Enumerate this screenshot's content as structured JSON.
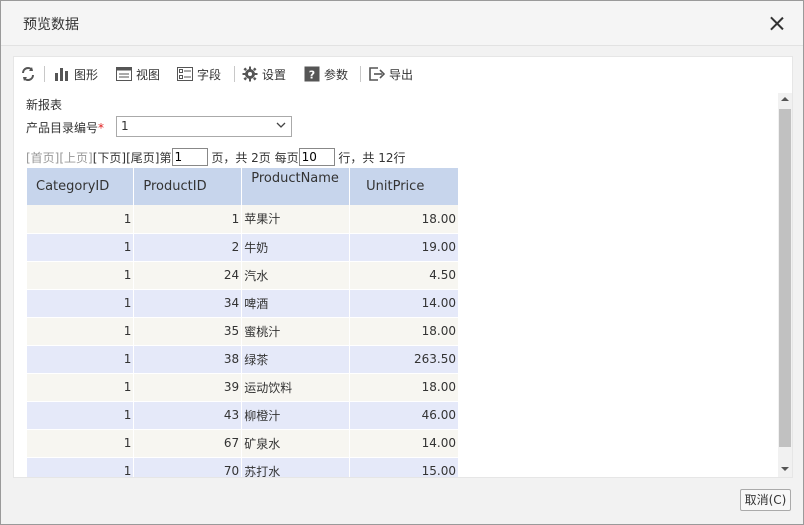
{
  "dialog": {
    "title": "预览数据",
    "cancel_label": "取消(C)"
  },
  "toolbar": {
    "chart_label": "图形",
    "view_label": "视图",
    "field_label": "字段",
    "settings_label": "设置",
    "param_label": "参数",
    "export_label": "导出"
  },
  "report": {
    "name": "新报表",
    "param_name": "产品目录编号",
    "param_required_mark": "*",
    "param_value": "1"
  },
  "pager": {
    "first": "[首页]",
    "prev": "[上页]",
    "next": "[下页]",
    "last": "[尾页]",
    "page_prefix": " 第",
    "current_page": "1",
    "page_mid": " 页，共 2页 每页",
    "page_size": "10",
    "page_suffix": " 行，共 12行"
  },
  "table": {
    "headers": [
      "CategoryID",
      "ProductID",
      "ProductName",
      "UnitPrice"
    ],
    "rows": [
      [
        "1",
        "1",
        "苹果汁",
        "18.00"
      ],
      [
        "1",
        "2",
        "牛奶",
        "19.00"
      ],
      [
        "1",
        "24",
        "汽水",
        "4.50"
      ],
      [
        "1",
        "34",
        "啤酒",
        "14.00"
      ],
      [
        "1",
        "35",
        "蜜桃汁",
        "18.00"
      ],
      [
        "1",
        "38",
        "绿茶",
        "263.50"
      ],
      [
        "1",
        "39",
        "运动饮料",
        "18.00"
      ],
      [
        "1",
        "43",
        "柳橙汁",
        "46.00"
      ],
      [
        "1",
        "67",
        "矿泉水",
        "14.00"
      ],
      [
        "1",
        "70",
        "苏打水",
        "15.00"
      ]
    ]
  },
  "icons": {
    "refresh": "refresh-icon",
    "chart": "bar-chart-icon",
    "view": "view-icon",
    "field": "field-icon",
    "settings": "gear-icon",
    "param": "question-icon",
    "export": "export-icon"
  },
  "colors": {
    "header_bg": "#c7d5ec",
    "row_odd": "#f7f6f1",
    "row_even": "#e5e9f9"
  }
}
